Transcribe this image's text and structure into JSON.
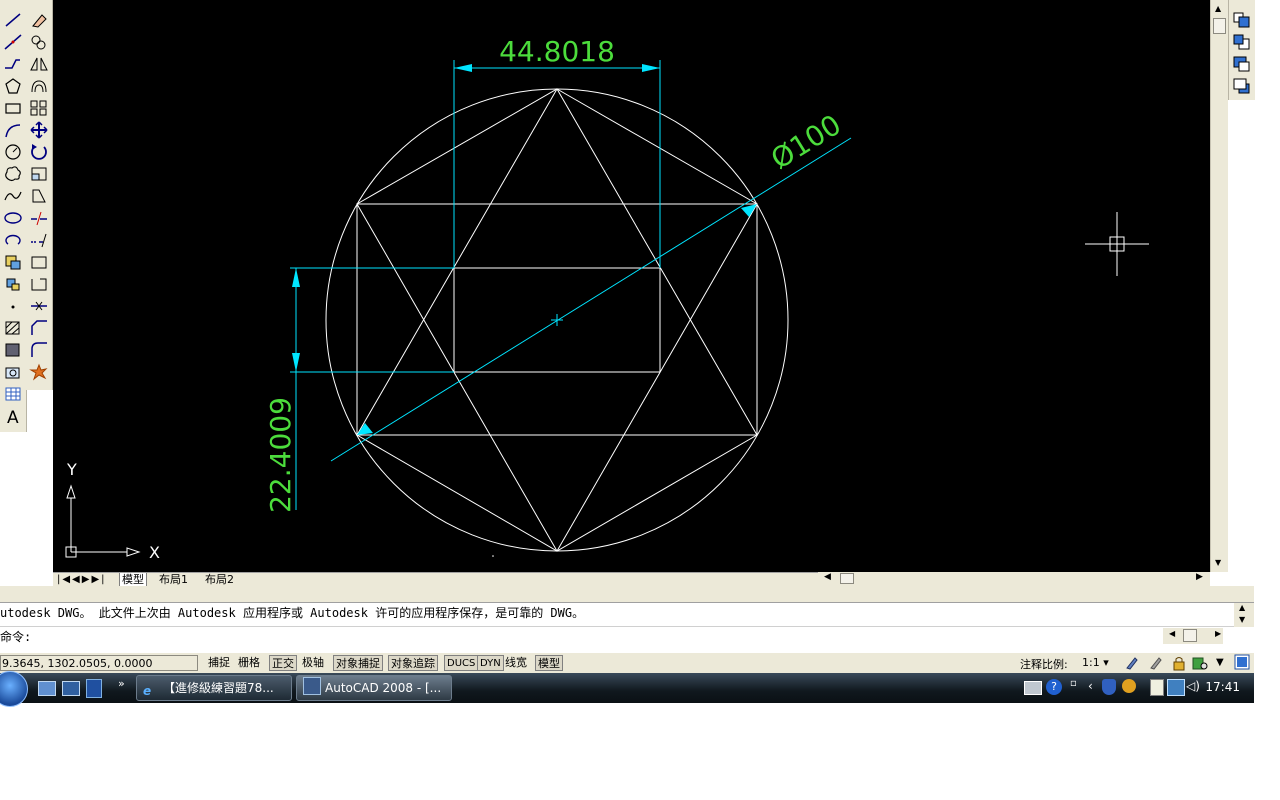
{
  "viewport": {
    "dimensions": {
      "width_label": "44.8018",
      "height_label": "22.4009",
      "diameter_label": "Ø100"
    },
    "ucs": {
      "y_label": "Y",
      "x_label": "X"
    }
  },
  "tabs": {
    "model": "模型",
    "layout1": "布局1",
    "layout2": "布局2"
  },
  "command": {
    "history": "utodesk DWG。  此文件上次由 Autodesk 应用程序或 Autodesk 许可的应用程序保存，是可靠的 DWG。",
    "prompt": "命令:"
  },
  "status": {
    "coordinates": "9.3645, 1302.0505, 0.0000",
    "toggles": [
      "捕捉",
      "栅格",
      "正交",
      "极轴",
      "对象捕捉",
      "对象追踪",
      "DUCS",
      "DYN",
      "线宽",
      "模型"
    ],
    "annotation_scale_label": "注释比例:",
    "annotation_scale_value": "1:1"
  },
  "taskbar": {
    "task1": "【進修級練習題78...",
    "task2": "AutoCAD 2008 - [...",
    "clock": "17:41"
  },
  "colors": {
    "canvas": "#000000",
    "geometry": "#ffffff",
    "dimension_lines": "#00e5ff",
    "dimension_text": "#4cdc3c",
    "toolbar": "#ece9d8"
  }
}
